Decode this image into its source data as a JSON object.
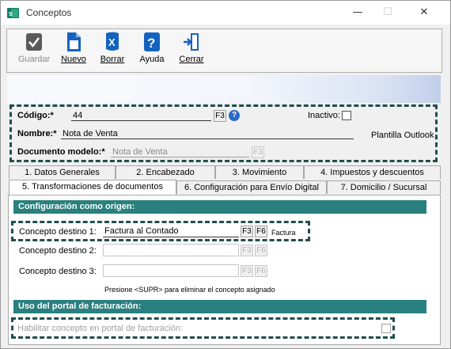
{
  "window": {
    "title": "Conceptos",
    "controls": {
      "minimize": "—",
      "maximize": "☐",
      "close": "✕"
    }
  },
  "toolbar": {
    "items": [
      {
        "label": "Guardar",
        "icon": "check-icon",
        "enabled": false
      },
      {
        "label": "Nuevo",
        "icon": "new-document-icon",
        "enabled": true
      },
      {
        "label": "Borrar",
        "icon": "delete-x-icon",
        "enabled": true
      },
      {
        "label": "Ayuda",
        "icon": "help-question-icon",
        "enabled": true
      },
      {
        "label": "Cerrar",
        "icon": "exit-door-icon",
        "enabled": true
      }
    ]
  },
  "header": {
    "codigo_label": "Código:*",
    "codigo_value": "44",
    "f3": "F3",
    "help_icon": "?",
    "inactivo_label": "Inactivo:",
    "nombre_label": "Nombre:*",
    "nombre_value": "Nota de Venta",
    "plantilla_label": "Plantilla Outlook",
    "documento_label": "Documento modelo:*",
    "documento_value": "Nota de Venta"
  },
  "tabs": {
    "row1": [
      "1. Datos Generales",
      "2. Encabezado",
      "3. Movimiento",
      "4. Impuestos y descuentos"
    ],
    "row2": [
      "5. Transformaciones de documentos",
      "6. Configuración para Envío Digital",
      "7. Domicilio / Sucursal"
    ],
    "active": "5. Transformaciones de documentos"
  },
  "origen": {
    "section_title": "Configuración como origen:",
    "destino1_label": "Concepto destino 1:",
    "destino1_value": "Factura al Contado",
    "destino1_type": "Factura",
    "destino2_label": "Concepto destino 2:",
    "destino3_label": "Concepto destino 3:",
    "f3": "F3",
    "f6": "F6",
    "hint": "Presione <SUPR> para eliminar el concepto asignado"
  },
  "portal": {
    "section_title": "Uso del portal de facturación:",
    "habilitar_label": "Habilitar concepto en portal de facturación:"
  },
  "colors": {
    "section_bg": "#2a7f7f",
    "dashed_border": "#1f4e4e",
    "toolbar_icon_blue": "#1563c0"
  }
}
